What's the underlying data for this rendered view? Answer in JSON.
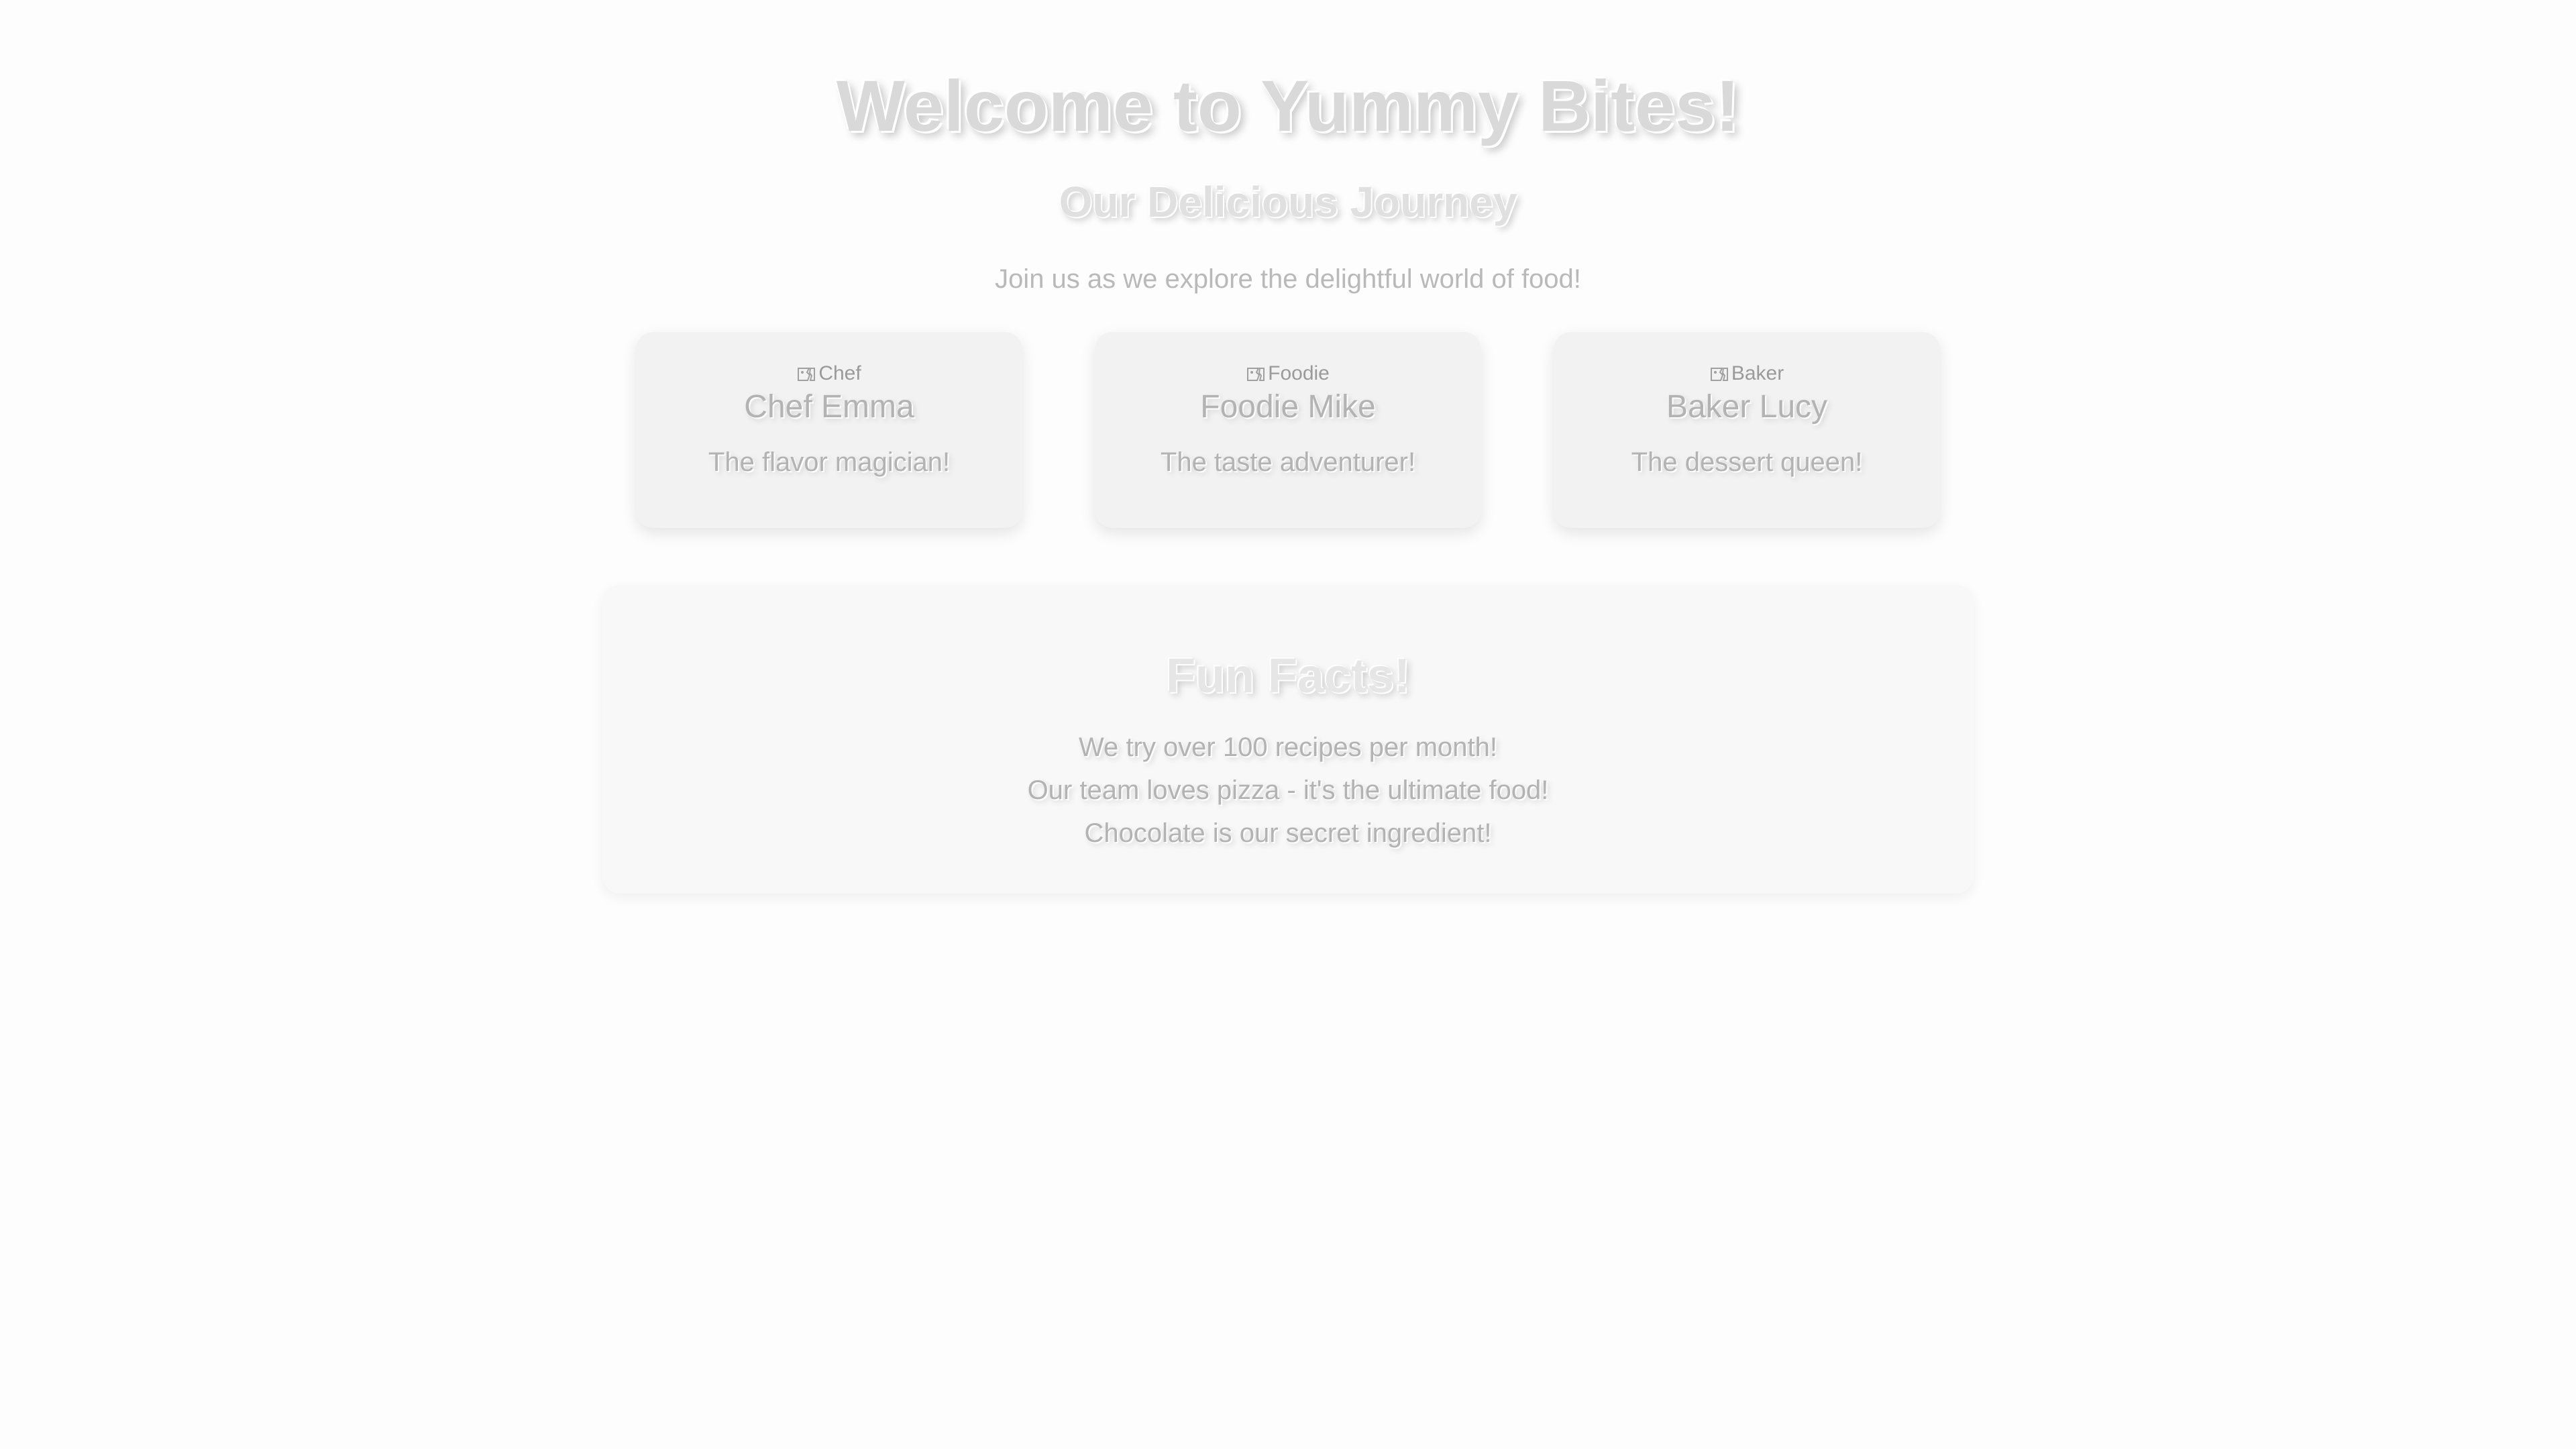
{
  "header": {
    "title": "Welcome to Yummy Bites!",
    "subtitle": "Our Delicious Journey",
    "intro": "Join us as we explore the delightful world of food!"
  },
  "team": [
    {
      "image_alt": "Chef",
      "name": "Chef Emma",
      "tagline": "The flavor magician!"
    },
    {
      "image_alt": "Foodie",
      "name": "Foodie Mike",
      "tagline": "The taste adventurer!"
    },
    {
      "image_alt": "Baker",
      "name": "Baker Lucy",
      "tagline": "The dessert queen!"
    }
  ],
  "facts": {
    "title": "Fun Facts!",
    "items": [
      "We try over 100 recipes per month!",
      "Our team loves pizza - it's the ultimate food!",
      "Chocolate is our secret ingredient!"
    ]
  },
  "icons": {
    "broken_image": "broken-image-icon"
  },
  "colors": {
    "background": "#fdfdfd",
    "card_background": "#f2f2f2",
    "facts_background": "#f8f8f8",
    "text": "#b9b9b9"
  }
}
